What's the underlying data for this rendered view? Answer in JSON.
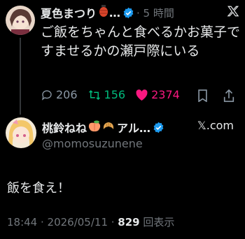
{
  "tweet": {
    "author_name": "夏色まつり",
    "author_name_suffix": "…",
    "time_ago": "· 5 時間",
    "body": "ご飯をちゃんと食べるかお菓子ですませるかの瀬戸際にいる",
    "replies": "206",
    "retweets": "156",
    "likes": "2374"
  },
  "reply": {
    "author_name": "桃鈴ねね",
    "author_name_suffix": "アル…",
    "site": "𝕏.com",
    "handle": "@momosuzunene",
    "text": "飯を食え！",
    "timestamp": "18:44 · 2026/05/11 · ",
    "views": "829",
    "views_label": " 回表示"
  },
  "colors": {
    "background": "#000000",
    "text": "#e7e9ea",
    "muted": "#71767b",
    "verified": "#1d9bf0",
    "retweet": "#00ba7c",
    "like": "#f91880"
  },
  "icons": [
    "x-logo-icon",
    "verified-badge-icon",
    "reply-icon",
    "retweet-icon",
    "heart-icon",
    "bookmark-icon",
    "share-icon",
    "peach-emoji-icon",
    "croissant-emoji-icon",
    "lantern-emoji-icon"
  ]
}
